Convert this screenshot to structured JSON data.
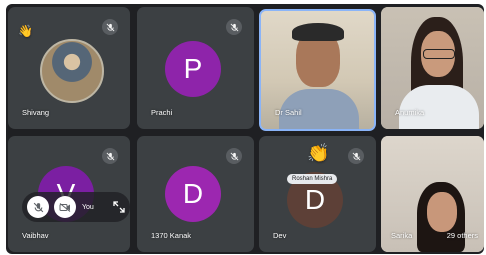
{
  "tiles": [
    {
      "name": "Shivang",
      "muted": true,
      "hand": "👋"
    },
    {
      "name": "Prachi",
      "initial": "P",
      "avatar_color": "#8e24aa",
      "muted": true
    },
    {
      "name": "Dr Sahil",
      "muted": false,
      "speaking": true
    },
    {
      "name": "Anumika",
      "muted": true
    },
    {
      "name": "Vaibhav",
      "initial": "V",
      "avatar_color": "#7b1fa2",
      "muted": true
    },
    {
      "name": "1370 Kanak",
      "initial": "D",
      "avatar_color": "#9c27b0",
      "muted": true
    },
    {
      "name": "Dev",
      "initial": "D",
      "avatar_color": "#5d4037",
      "muted": true,
      "hand": "👏",
      "reaction_label": "Roshan Mishra"
    },
    {
      "name": "Sarika",
      "muted": false
    }
  ],
  "others": "29 others",
  "self_controls": {
    "label": "You",
    "icons": [
      "mic-off-icon",
      "camera-off-icon",
      "expand-icon"
    ]
  },
  "colors": {
    "speaking_border": "#8ab4f8",
    "tile_bg": "#3c4043",
    "grid_bg": "#1f2023"
  }
}
